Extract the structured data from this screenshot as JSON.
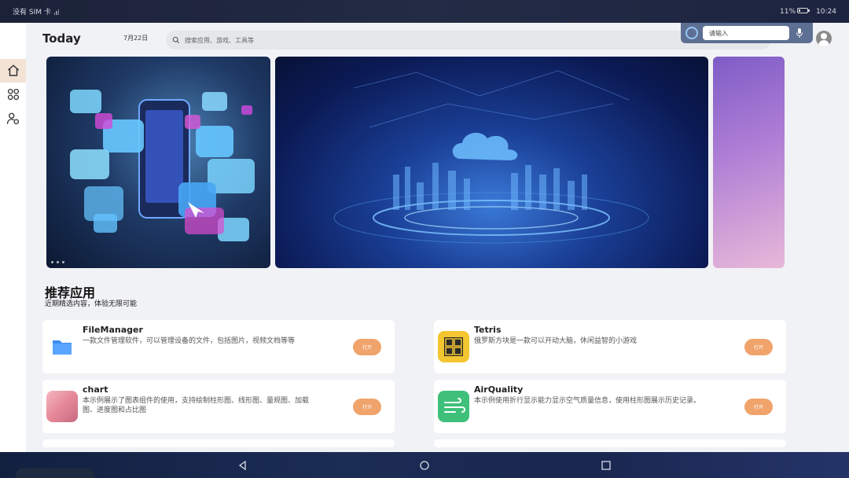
{
  "status_bar": {
    "sim_text": "没有 SIM 卡",
    "battery_percent": "11%",
    "time": "10:24"
  },
  "header": {
    "title": "Today",
    "date": "7月22日",
    "search_placeholder": "搜索应用、游戏、工具等"
  },
  "voice_input": {
    "placeholder": "请输入"
  },
  "sidebar": {
    "items": [
      {
        "icon": "home-icon",
        "active": true
      },
      {
        "icon": "apps-grid-icon",
        "active": false
      },
      {
        "icon": "user-settings-icon",
        "active": false
      }
    ]
  },
  "banners": [
    {
      "theme": "phone-ui-icons"
    },
    {
      "theme": "cloud-network-city"
    },
    {
      "theme": "purple-abstract"
    }
  ],
  "section": {
    "title": "推荐应用",
    "subtitle": "近期精选内容，体验无限可能"
  },
  "apps": [
    {
      "name": "FileManager",
      "desc": "一款文件管理软件，可以管理设备的文件，包括图片，视频文档等等",
      "open_label": "打开",
      "icon": "folder-icon"
    },
    {
      "name": "Tetris",
      "desc": "俄罗斯方块是一款可以开动大脑，休闲益智的小游戏",
      "open_label": "打开",
      "icon": "tetris-icon"
    },
    {
      "name": "chart",
      "desc": "本示例展示了图表组件的使用，支持绘制柱形图、线形图、量规图、加载图、进度图和占比图",
      "open_label": "打开",
      "icon": "chart-thumbnail-icon"
    },
    {
      "name": "AirQuality",
      "desc": "本示例使用折行显示能力显示空气质量信息，使用柱形图展示历史记录。",
      "open_label": "打开",
      "icon": "wind-icon"
    }
  ],
  "colors": {
    "accent": "#f0a36b",
    "sidebar_active": "#f2e3d5",
    "background": "#f1f2f5"
  }
}
